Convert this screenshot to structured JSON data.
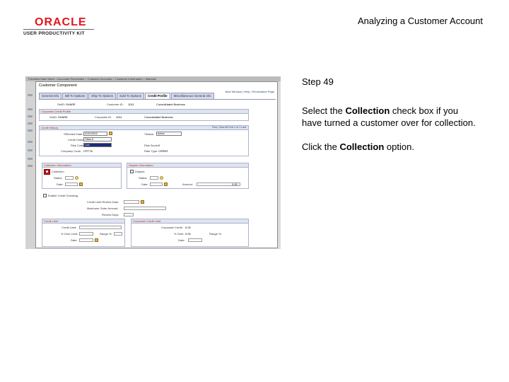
{
  "logo": {
    "brand": "ORACLE",
    "product": "USER PRODUCTIVITY KIT"
  },
  "slide_title": "Analyzing a Customer Account",
  "step": {
    "title": "Step 49"
  },
  "instructions": {
    "p1_pre": "Select the ",
    "p1_bold": "Collection",
    "p1_post": " check box if you have turned a customer over for collection.",
    "p2_pre": "Click the ",
    "p2_bold": "Collection",
    "p2_post": " option."
  },
  "screenshot": {
    "crumbs": "Favorites   Main Menu   >  Accounts Receivable  >  Customer Accounts  >  Customer Information  >  Maintain",
    "window_title": "Customer Component",
    "header_links": "New Window | Help | Personalize Page",
    "tabs": [
      "General Info",
      "Bill To Options",
      "Ship To Options",
      "Sold To Options",
      "Credit Profile",
      "Miscellaneous General Info"
    ],
    "active_tab": "Credit Profile",
    "setid_label": "SetID:",
    "setid_value": "SHARE",
    "customer_id_label": "Customer ID:",
    "customer_id_value": "1011",
    "customer_name": "Consolidated Business",
    "corp_section": "Corporate Credit Profile",
    "corp_setid_label": "SetID:",
    "corp_setid_value": "SHARE",
    "corp_customer_label": "Corporate ID:",
    "corp_customer_value": "1011",
    "corp_customer_name": "Consolidated Business",
    "credit_history": {
      "header": "Credit History",
      "nav": "Find | View All   First  1 of 1  Last",
      "effdate_label": "*Effective Date:",
      "effdate_value": "01/01/2012",
      "status_label": "*Status:",
      "status_value": "Active",
      "credit_class_label": "Credit Class:",
      "credit_class_value": "Class A",
      "risk_label": "Risk Code:",
      "risk_value": "Low",
      "company_code_label": "Company Code:",
      "company_code_value": "CPT7A",
      "risk_score_label": "Risk Score:",
      "risk_score_value": "0",
      "rate_type_label": "Rate Type:",
      "rate_type_value": "CRRNT"
    },
    "collection": {
      "header": "Collection Information",
      "check_label": "Collection",
      "status_label": "Status:",
      "date_label": "Date:"
    },
    "dispute": {
      "header": "Dispute Information",
      "check_label": "Dispute",
      "status_label": "Status:",
      "date_label": "Date:",
      "amount_label": "Amount:",
      "amount_value": "0.00"
    },
    "enable_credit_label": "Enable Credit Checking",
    "credit_limit_review_label": "Credit Limit Review Date:",
    "max_order_label": "Maximum Order Amount:",
    "review_days_label": "Review Days:",
    "credit_limit": {
      "header": "Credit Limit",
      "credit_limit_label": "Credit Limit:",
      "pct_over_label": "% Over Limit:",
      "range_label": "Range %:",
      "date_label": "Date:"
    },
    "corp_credit_limit": {
      "header": "Corporate Credit Limit",
      "corp_credit_label": "Corporate Credit:",
      "corp_credit_value": "0.00",
      "over_label": "% Over:",
      "over_value": "0.00",
      "range_label": "Range %:",
      "date_label": "Date:"
    }
  }
}
